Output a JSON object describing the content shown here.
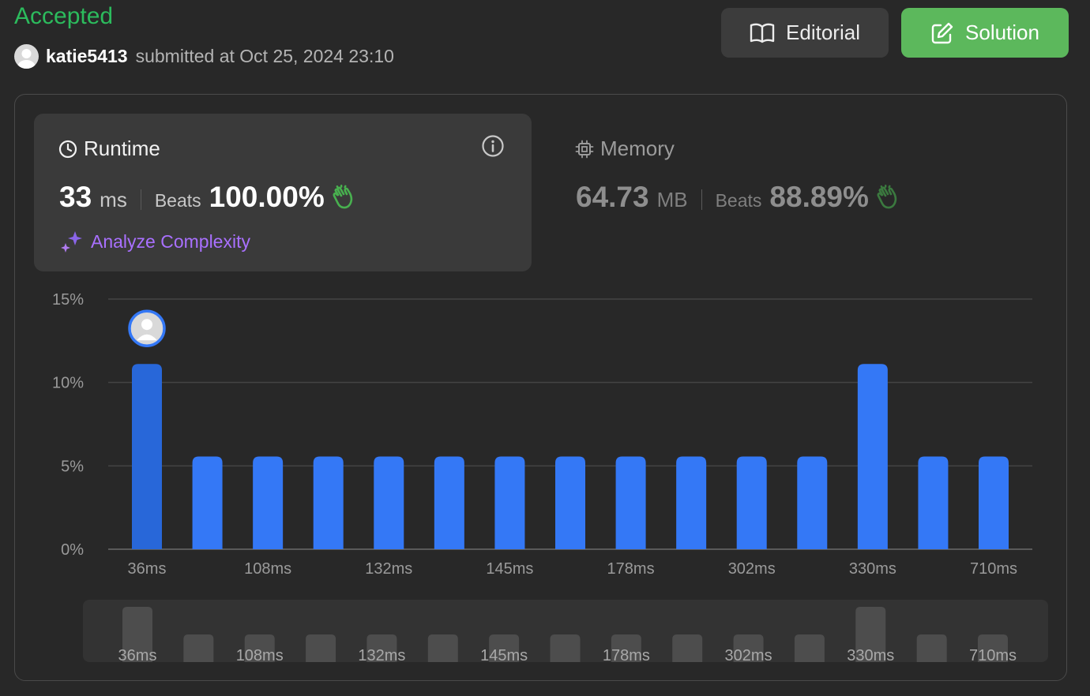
{
  "header": {
    "status": "Accepted",
    "username": "katie5413",
    "submitted_text": "submitted at Oct 25, 2024 23:10",
    "editorial_label": "Editorial",
    "solution_label": "Solution"
  },
  "runtime": {
    "title": "Runtime",
    "value": "33",
    "unit": "ms",
    "beats_label": "Beats",
    "beats_value": "100.00%",
    "analyze_label": "Analyze Complexity"
  },
  "memory": {
    "title": "Memory",
    "value": "64.73",
    "unit": "MB",
    "beats_label": "Beats",
    "beats_value": "88.89%"
  },
  "colors": {
    "accepted_green": "#2cbb5d",
    "solution_button": "#5cb85c",
    "bar_blue": "#3478f6",
    "bar_selected": "#2867d9",
    "analyze_purple": "#a970ff"
  },
  "chart_data": {
    "type": "bar",
    "title": "",
    "xlabel": "",
    "ylabel": "",
    "yticks": [
      "0%",
      "5%",
      "10%",
      "15%"
    ],
    "ylim": [
      0,
      15
    ],
    "xtick_labels": [
      "36ms",
      "108ms",
      "132ms",
      "145ms",
      "178ms",
      "302ms",
      "330ms",
      "710ms"
    ],
    "categories": [
      "36ms",
      "",
      "108ms",
      "",
      "132ms",
      "",
      "145ms",
      "",
      "178ms",
      "",
      "302ms",
      "",
      "330ms",
      "",
      "710ms"
    ],
    "values": [
      11.11,
      5.56,
      5.56,
      5.56,
      5.56,
      5.56,
      5.56,
      5.56,
      5.56,
      5.56,
      5.56,
      5.56,
      11.11,
      5.56,
      5.56
    ],
    "selected_index": 0,
    "grid": true
  }
}
